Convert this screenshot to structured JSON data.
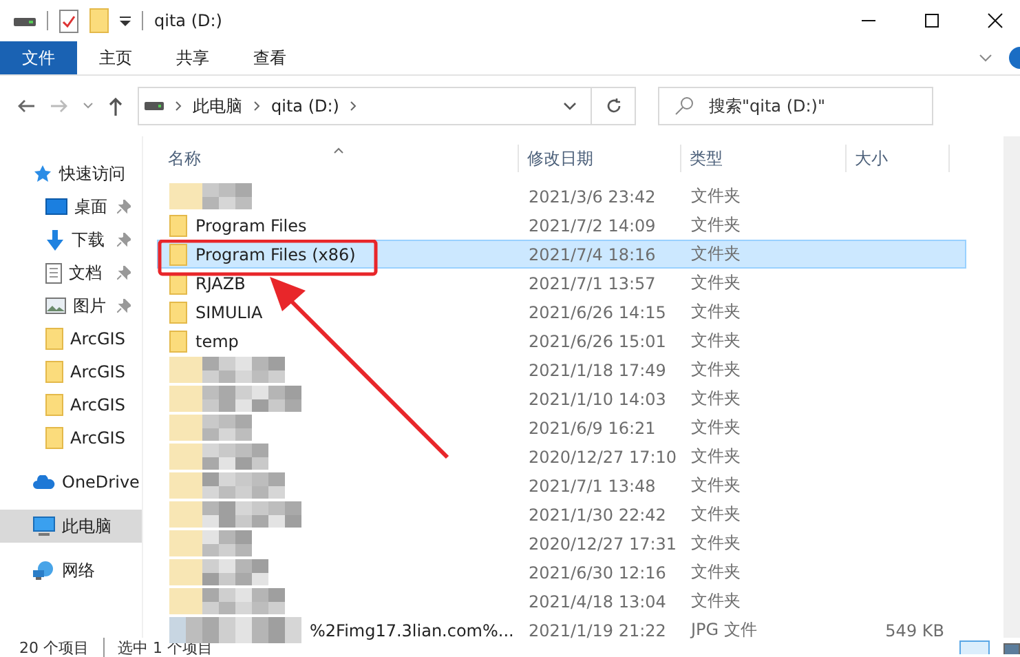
{
  "title_bar": {
    "title": "qita (D:)"
  },
  "ribbon": {
    "tabs": [
      {
        "label": "文件",
        "selected": true
      },
      {
        "label": "主页",
        "selected": false
      },
      {
        "label": "共享",
        "selected": false
      },
      {
        "label": "查看",
        "selected": false
      }
    ]
  },
  "address": {
    "crumbs": [
      "此电脑",
      "qita (D:)"
    ]
  },
  "search": {
    "placeholder": "搜索\"qita (D:)\""
  },
  "columns": [
    "名称",
    "修改日期",
    "类型",
    "大小"
  ],
  "sidebar": {
    "items": [
      {
        "label": "快速访问",
        "kind": "star",
        "pinned": false,
        "selected": false
      },
      {
        "label": "桌面",
        "kind": "desktop",
        "pinned": true,
        "selected": false
      },
      {
        "label": "下载",
        "kind": "download",
        "pinned": true,
        "selected": false
      },
      {
        "label": "文档",
        "kind": "document",
        "pinned": true,
        "selected": false
      },
      {
        "label": "图片",
        "kind": "picture",
        "pinned": true,
        "selected": false
      },
      {
        "label": "ArcGIS",
        "kind": "folder",
        "pinned": false,
        "selected": false
      },
      {
        "label": "ArcGIS",
        "kind": "folder",
        "pinned": false,
        "selected": false
      },
      {
        "label": "ArcGIS",
        "kind": "folder",
        "pinned": false,
        "selected": false
      },
      {
        "label": "ArcGIS",
        "kind": "folder",
        "pinned": false,
        "selected": false
      },
      {
        "label": "OneDrive",
        "kind": "cloud",
        "pinned": false,
        "selected": false
      },
      {
        "label": "此电脑",
        "kind": "pc",
        "pinned": false,
        "selected": true
      },
      {
        "label": "网络",
        "kind": "network",
        "pinned": false,
        "selected": false
      }
    ]
  },
  "rows": [
    {
      "kind": "blurred",
      "date": "2021/3/6 23:42",
      "type": "文件夹",
      "selected": false
    },
    {
      "kind": "folder",
      "name": "Program Files",
      "date": "2021/7/2 14:09",
      "type": "文件夹",
      "selected": false
    },
    {
      "kind": "folder",
      "name": "Program Files (x86)",
      "date": "2021/7/4 18:16",
      "type": "文件夹",
      "selected": true
    },
    {
      "kind": "folder",
      "name": "RJAZB",
      "date": "2021/7/1 13:57",
      "type": "文件夹",
      "selected": false
    },
    {
      "kind": "folder",
      "name": "SIMULIA",
      "date": "2021/6/26 14:15",
      "type": "文件夹",
      "selected": false
    },
    {
      "kind": "folder",
      "name": "temp",
      "date": "2021/6/26 15:01",
      "type": "文件夹",
      "selected": false
    },
    {
      "kind": "blurred",
      "date": "2021/1/18 17:49",
      "type": "文件夹",
      "selected": false
    },
    {
      "kind": "blurred",
      "date": "2021/1/10 14:03",
      "type": "文件夹",
      "selected": false
    },
    {
      "kind": "blurred",
      "date": "2021/6/9 16:21",
      "type": "文件夹",
      "selected": false
    },
    {
      "kind": "blurred",
      "date": "2020/12/27 17:10",
      "type": "文件夹",
      "selected": false
    },
    {
      "kind": "blurred",
      "date": "2021/7/1 13:48",
      "type": "文件夹",
      "selected": false
    },
    {
      "kind": "blurred",
      "date": "2021/1/30 22:42",
      "type": "文件夹",
      "selected": false
    },
    {
      "kind": "blurred",
      "date": "2020/12/27 17:31",
      "type": "文件夹",
      "selected": false
    },
    {
      "kind": "blurred",
      "date": "2021/6/30 12:16",
      "type": "文件夹",
      "selected": false
    },
    {
      "kind": "blurred",
      "date": "2021/4/18 13:04",
      "type": "文件夹",
      "selected": false
    },
    {
      "kind": "file",
      "name": "%2Fimg17.3lian.com%...",
      "date": "2021/1/19 21:22",
      "type": "JPG 文件",
      "size": "549 KB",
      "selected": false
    }
  ],
  "status_bar": [
    "20 个项目",
    "选中 1 个项目"
  ]
}
